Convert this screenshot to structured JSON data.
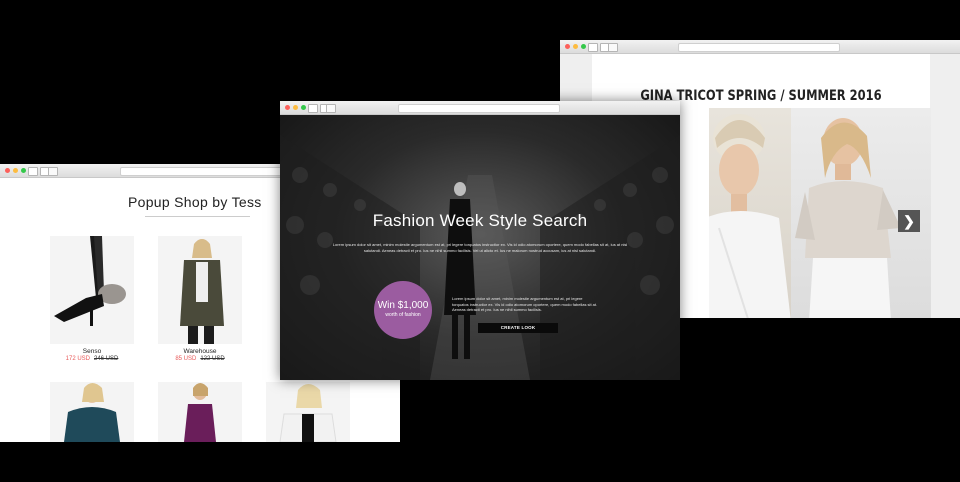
{
  "gina": {
    "title": "GINA TRICOT SPRING / SUMMER 2016",
    "next_arrow": "❯"
  },
  "popup": {
    "title": "Popup Shop by Tess",
    "products": [
      {
        "name": "Senso",
        "price": "172 USD",
        "old_price": "246 USD"
      },
      {
        "name": "Warehouse",
        "price": "85 USD",
        "old_price": "122 USD"
      }
    ]
  },
  "fashion": {
    "title": "Fashion Week Style Search",
    "body": "Lorem ipsum dolor sit amet, minim molestie argumentum est at, pri legere torquatos instructior ex. Vis id odio atomorum oportere, quem modo fabellas sit at, ius at nisl salutandi. Aeneas detracti et pro. Ius ne nihil summo facilisis. Vel ut alicto et. Ius ne malorum nostrud accusam, ius at nisl salutandi.",
    "win_amount": "Win $1,000",
    "win_sub": "worth of fashion",
    "side_text": "Lorem ipsum dolor sit amet, minim molestie argumentum est at, pri legere torquatos instructior ex. Vis id odio atomorum oportere, quem modo fabellas sit at. Aeneas detracti et pro. Ius ne nihil summo facilisis.",
    "cta": "CREATE LOOK"
  },
  "colors": {
    "accent_purple": "#9b5ca0",
    "sale_red": "#e85a5a",
    "background": "#000000"
  }
}
